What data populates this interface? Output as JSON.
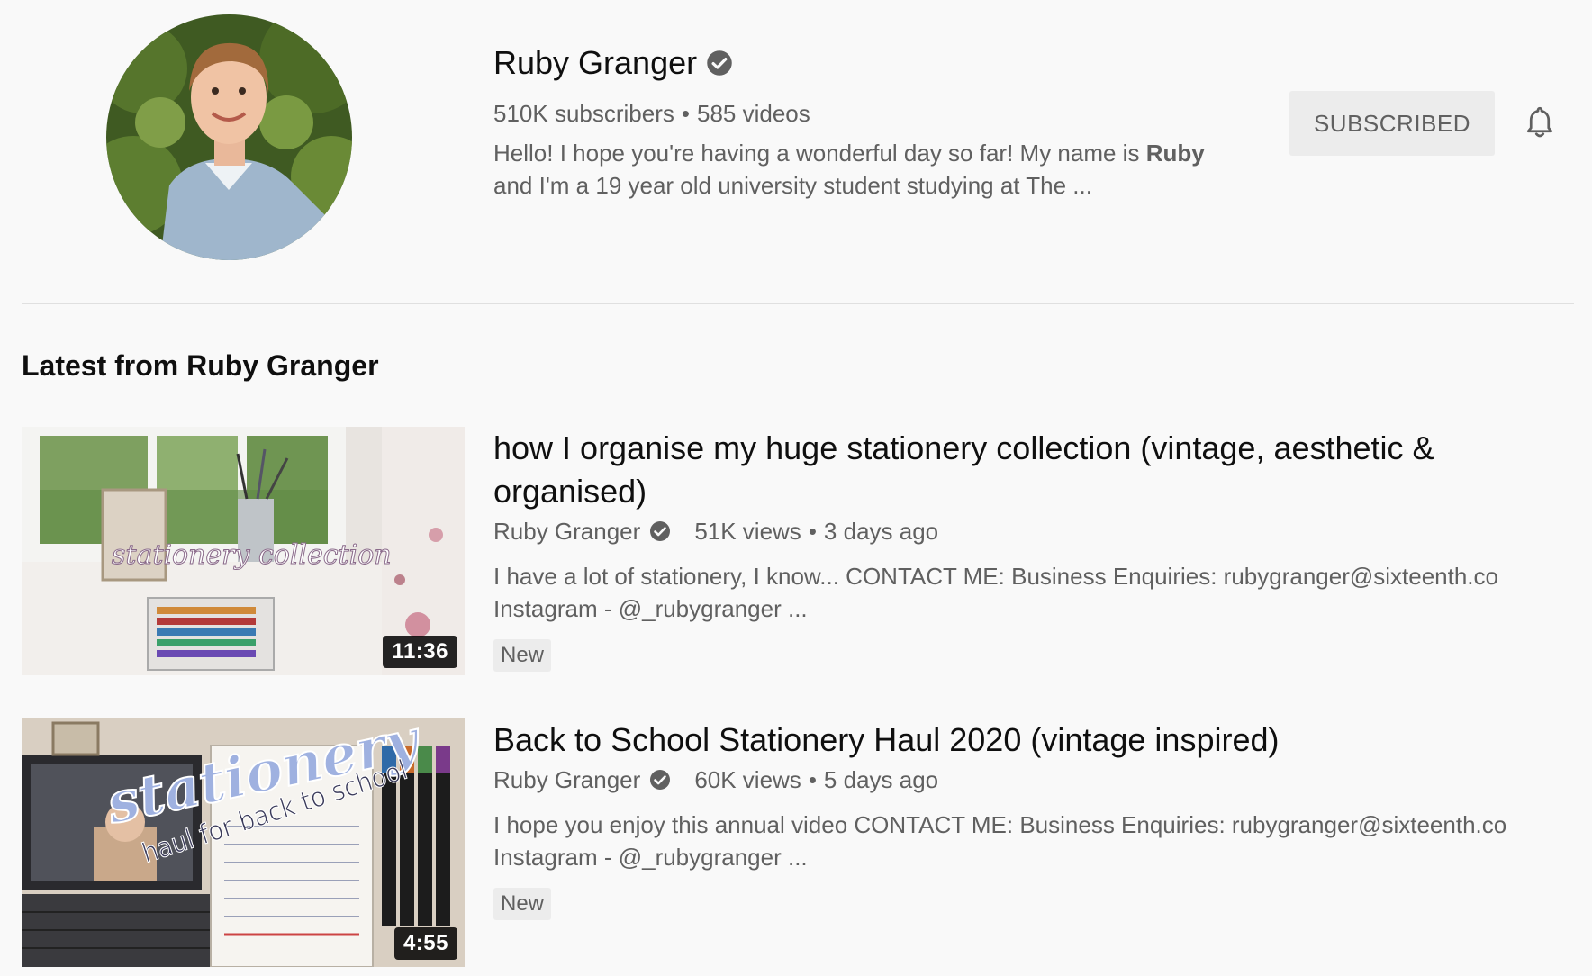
{
  "channel": {
    "name": "Ruby Granger",
    "subscribers": "510K subscribers",
    "separator": "•",
    "videos": "585 videos",
    "description_before": "Hello! I hope you're having a wonderful day so far! My name is ",
    "description_bold": "Ruby",
    "description_after": " and I'm a 19 year old university student studying at The ...",
    "subscribe_label": "SUBSCRIBED",
    "bell_icon": "bell-icon",
    "verified_icon": "verified-check-icon"
  },
  "section": {
    "title": "Latest from Ruby Granger"
  },
  "videos": [
    {
      "title": "how I organise my huge stationery collection (vintage, aesthetic & organised)",
      "author": "Ruby Granger",
      "views": "51K views",
      "separator": "•",
      "age": "3 days ago",
      "description_line1": "I have a lot of stationery, I know... CONTACT ME: Business Enquiries: rubygranger@sixteenth.co",
      "description_line2": "Instagram - @_rubygranger ...",
      "badge": "New",
      "duration": "11:36",
      "thumbnail_text": "stationery collection"
    },
    {
      "title": "Back to School Stationery Haul 2020 (vintage inspired)",
      "author": "Ruby Granger",
      "views": "60K views",
      "separator": "•",
      "age": "5 days ago",
      "description_line1": "I hope you enjoy this annual video CONTACT ME: Business Enquiries: rubygranger@sixteenth.co",
      "description_line2": "Instagram - @_rubygranger ...",
      "badge": "New",
      "duration": "4:55",
      "thumbnail_text_1": "stationery",
      "thumbnail_text_2": "haul for back to school"
    }
  ],
  "colors": {
    "background": "#f9f9f9",
    "text_primary": "#0f0f0f",
    "text_secondary": "#606060",
    "button_bg": "#ececec",
    "divider": "#e0e0e0"
  }
}
